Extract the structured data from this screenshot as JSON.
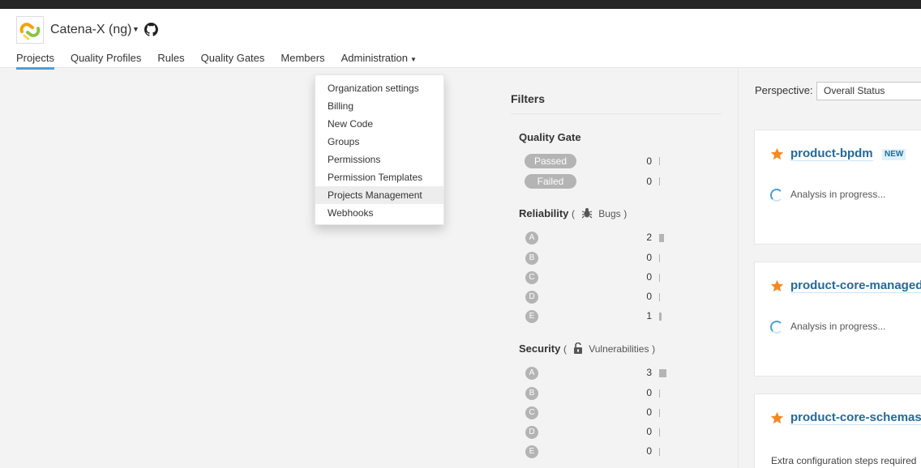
{
  "org": {
    "name": "Catena-X (ng)",
    "logo_icon": "sonar-org-logo",
    "github_icon": "github-icon"
  },
  "nav": [
    {
      "label": "Projects",
      "active": true
    },
    {
      "label": "Quality Profiles"
    },
    {
      "label": "Rules"
    },
    {
      "label": "Quality Gates"
    },
    {
      "label": "Members"
    },
    {
      "label": "Administration",
      "has_caret": true
    }
  ],
  "admin_menu": [
    "Organization settings",
    "Billing",
    "New Code",
    "Groups",
    "Permissions",
    "Permission Templates",
    "Projects Management",
    "Webhooks"
  ],
  "filters": {
    "title": "Filters",
    "quality_gate": {
      "title": "Quality Gate",
      "options": [
        {
          "label": "Passed",
          "count": "0"
        },
        {
          "label": "Failed",
          "count": "0"
        }
      ]
    },
    "reliability": {
      "title": "Reliability",
      "open": "(",
      "sub": "Bugs",
      "close": ")",
      "ratings": [
        {
          "label": "A",
          "count": "2"
        },
        {
          "label": "B",
          "count": "0"
        },
        {
          "label": "C",
          "count": "0"
        },
        {
          "label": "D",
          "count": "0"
        },
        {
          "label": "E",
          "count": "1"
        }
      ]
    },
    "security": {
      "title": "Security",
      "open": "(",
      "sub": "Vulnerabilities",
      "close": ")",
      "ratings": [
        {
          "label": "A",
          "count": "3"
        },
        {
          "label": "B",
          "count": "0"
        },
        {
          "label": "C",
          "count": "0"
        },
        {
          "label": "D",
          "count": "0"
        },
        {
          "label": "E",
          "count": "0"
        }
      ]
    }
  },
  "perspective": {
    "label": "Perspective:",
    "value": "Overall Status"
  },
  "projects": [
    {
      "name": "product-bpdm",
      "badge": "NEW",
      "status": "Analysis in progress..."
    },
    {
      "name": "product-core-managed",
      "status": "Analysis in progress..."
    },
    {
      "name": "product-core-schemas",
      "status": "Extra configuration steps required"
    }
  ],
  "colors": {
    "accent": "#4b9fd5",
    "link": "#236a97",
    "star": "#f18a24",
    "pill": "#b4b4b4"
  }
}
